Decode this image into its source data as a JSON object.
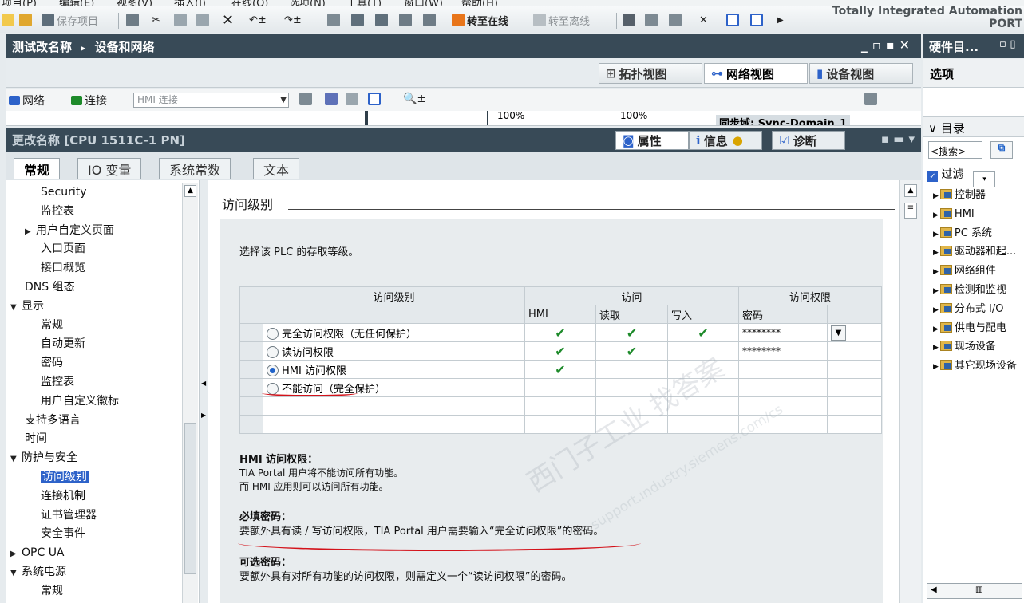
{
  "menu": {
    "items": [
      "项目(P)",
      "编辑(E)",
      "视图(V)",
      "插入(I)",
      "在线(O)",
      "选项(N)",
      "工具(T)",
      "窗口(W)",
      "帮助(H)"
    ]
  },
  "toolbar": {
    "save_project": "保存项目",
    "go_online": "转至在线",
    "go_offline": "转至离线"
  },
  "brand": {
    "line1": "Totally Integrated Automation",
    "line2": "PORT"
  },
  "editor": {
    "breadcrumb_root": "测试改名称",
    "breadcrumb_sep": "▸",
    "breadcrumb_current": "设备和网络",
    "views": {
      "topology": "拓扑视图",
      "network": "网络视图",
      "device": "设备视图"
    },
    "net_btn": "网络",
    "conn_btn": "连接",
    "conn_placeholder": "HMI 连接",
    "zoom1": "100%",
    "zoom2": "100%",
    "sync_domain": "同步域: Sync-Domain_1"
  },
  "inspector": {
    "title": "更改名称 [CPU 1511C-1 PN]",
    "tab_properties": "属性",
    "tab_info": "信息",
    "tab_diag": "诊断",
    "subtabs": [
      "常规",
      "IO 变量",
      "系统常数",
      "文本"
    ]
  },
  "tree": {
    "items": [
      {
        "label": "Security",
        "indent": 2,
        "arrow": ""
      },
      {
        "label": "监控表",
        "indent": 2,
        "arrow": ""
      },
      {
        "label": "用户自定义页面",
        "indent": 1,
        "arrow": "▶"
      },
      {
        "label": "入口页面",
        "indent": 2,
        "arrow": ""
      },
      {
        "label": "接口概览",
        "indent": 2,
        "arrow": ""
      },
      {
        "label": "DNS 组态",
        "indent": 1,
        "arrow": ""
      },
      {
        "label": "显示",
        "indent": 0,
        "arrow": "▼"
      },
      {
        "label": "常规",
        "indent": 2,
        "arrow": ""
      },
      {
        "label": "自动更新",
        "indent": 2,
        "arrow": ""
      },
      {
        "label": "密码",
        "indent": 2,
        "arrow": ""
      },
      {
        "label": "监控表",
        "indent": 2,
        "arrow": ""
      },
      {
        "label": "用户自定义徽标",
        "indent": 2,
        "arrow": ""
      },
      {
        "label": "支持多语言",
        "indent": 1,
        "arrow": ""
      },
      {
        "label": "时间",
        "indent": 1,
        "arrow": ""
      },
      {
        "label": "防护与安全",
        "indent": 0,
        "arrow": "▼"
      },
      {
        "label": "访问级别",
        "indent": 2,
        "arrow": "",
        "selected": true
      },
      {
        "label": "连接机制",
        "indent": 2,
        "arrow": ""
      },
      {
        "label": "证书管理器",
        "indent": 2,
        "arrow": ""
      },
      {
        "label": "安全事件",
        "indent": 2,
        "arrow": ""
      },
      {
        "label": "OPC UA",
        "indent": 0,
        "arrow": "▶"
      },
      {
        "label": "系统电源",
        "indent": 0,
        "arrow": "▼"
      },
      {
        "label": "常规",
        "indent": 2,
        "arrow": ""
      }
    ]
  },
  "content": {
    "section_title": "访问级别",
    "intro": "选择该 PLC 的存取等级。",
    "table": {
      "h_level": "访问级别",
      "h_access": "访问",
      "h_perm": "访问权限",
      "sub_hmi": "HMI",
      "sub_read": "读取",
      "sub_write": "写入",
      "sub_pwd": "密码",
      "rows": [
        {
          "label": "完全访问权限（无任何保护）",
          "hmi": "✔",
          "read": "✔",
          "write": "✔",
          "pwd": "********",
          "selected": false
        },
        {
          "label": "读访问权限",
          "hmi": "✔",
          "read": "✔",
          "write": "",
          "pwd": "********",
          "selected": false
        },
        {
          "label": "HMI 访问权限",
          "hmi": "✔",
          "read": "",
          "write": "",
          "pwd": "",
          "selected": true
        },
        {
          "label": "不能访问（完全保护）",
          "hmi": "",
          "read": "",
          "write": "",
          "pwd": "",
          "selected": false
        }
      ]
    },
    "desc_title": "HMI 访问权限：",
    "desc_line1": "TIA Portal 用户将不能访问所有功能。",
    "desc_line2": "而 HMI 应用则可以访问所有功能。",
    "req_title": "必填密码：",
    "req_text": "要额外具有读 / 写访问权限，TIA Portal 用户需要输入“完全访问权限”的密码。",
    "opt_title": "可选密码：",
    "opt_text": "要额外具有对所有功能的访问权限，则需定义一个“读访问权限”的密码。"
  },
  "watermark": {
    "line1": "西门子工业  找答案",
    "line2": "support.industry.siemens.com/cs"
  },
  "hardware": {
    "title": "硬件目...",
    "options": "选项",
    "catalog": "目录",
    "search": "<搜索>",
    "filter": "过滤",
    "items": [
      "控制器",
      "HMI",
      "PC 系统",
      "驱动器和起...",
      "网络组件",
      "检测和监视",
      "分布式 I/O",
      "供电与配电",
      "现场设备",
      "其它现场设备"
    ]
  },
  "colors": {
    "titlebar": "#384a57",
    "selection": "#2d62c9",
    "check": "#1d8a2a",
    "annotation": "#d3121a"
  }
}
